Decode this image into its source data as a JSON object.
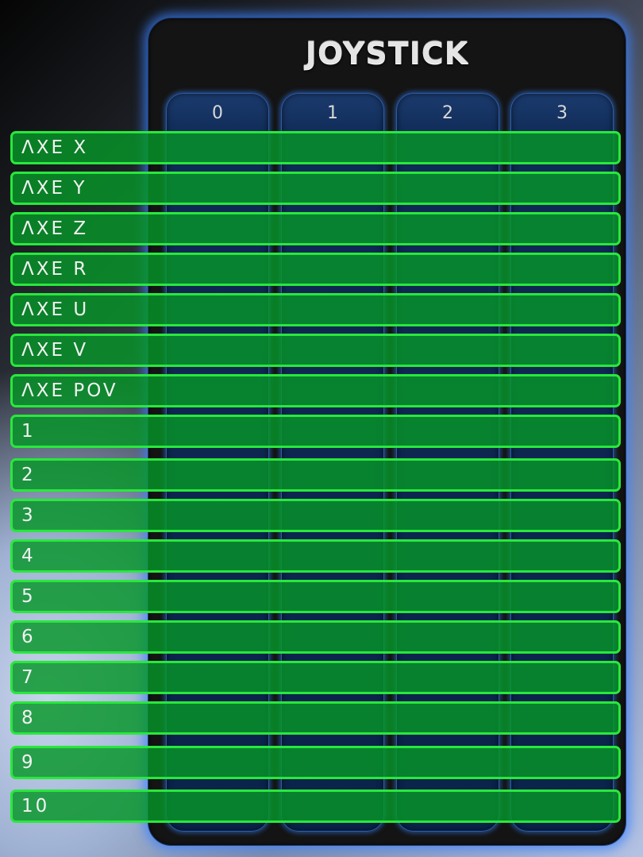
{
  "panel": {
    "title": "JOYSTICK"
  },
  "columns": [
    "0",
    "1",
    "2",
    "3"
  ],
  "rows": [
    "ΛXE X",
    "ΛXE Y",
    "ΛXE Z",
    "ΛXE R",
    "ΛXE U",
    "ΛXE V",
    "ΛXE POV",
    "1",
    "2",
    "3",
    "4",
    "5",
    "6",
    "7",
    "8",
    "9",
    "10"
  ],
  "colors": {
    "panel": "#141414",
    "column": "#0f2a55",
    "row_fill": "#0b962a",
    "row_border": "#29e83c",
    "glow": "#3c82ff"
  }
}
